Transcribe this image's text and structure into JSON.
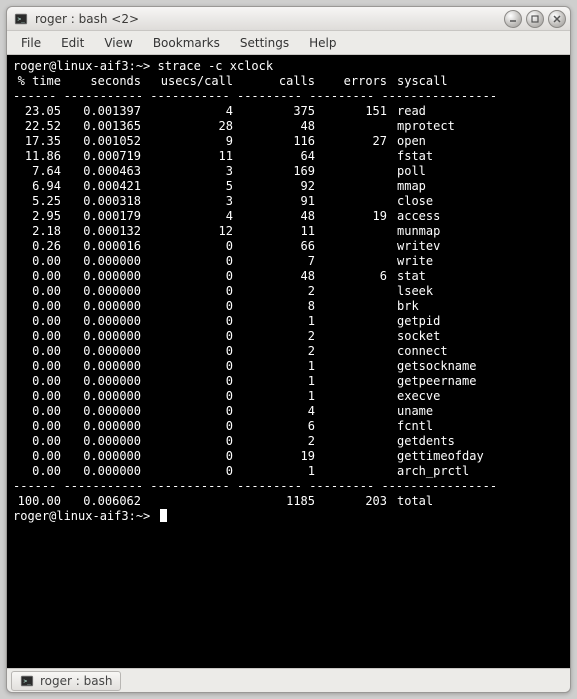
{
  "window": {
    "title": "roger : bash <2>"
  },
  "menus": {
    "file": "File",
    "edit": "Edit",
    "view": "View",
    "bookmarks": "Bookmarks",
    "settings": "Settings",
    "help": "Help"
  },
  "terminal": {
    "prompt": "roger@linux-aif3:~>",
    "command": "strace -c xclock",
    "header": {
      "time": "% time",
      "seconds": "seconds",
      "usecs": "usecs/call",
      "calls": "calls",
      "errors": "errors",
      "syscall": "syscall"
    },
    "dash": "------ ----------- ----------- --------- --------- ----------------",
    "rows": [
      {
        "time": "23.05",
        "seconds": "0.001397",
        "usecs": "4",
        "calls": "375",
        "errors": "151",
        "syscall": "read"
      },
      {
        "time": "22.52",
        "seconds": "0.001365",
        "usecs": "28",
        "calls": "48",
        "errors": "",
        "syscall": "mprotect"
      },
      {
        "time": "17.35",
        "seconds": "0.001052",
        "usecs": "9",
        "calls": "116",
        "errors": "27",
        "syscall": "open"
      },
      {
        "time": "11.86",
        "seconds": "0.000719",
        "usecs": "11",
        "calls": "64",
        "errors": "",
        "syscall": "fstat"
      },
      {
        "time": "7.64",
        "seconds": "0.000463",
        "usecs": "3",
        "calls": "169",
        "errors": "",
        "syscall": "poll"
      },
      {
        "time": "6.94",
        "seconds": "0.000421",
        "usecs": "5",
        "calls": "92",
        "errors": "",
        "syscall": "mmap"
      },
      {
        "time": "5.25",
        "seconds": "0.000318",
        "usecs": "3",
        "calls": "91",
        "errors": "",
        "syscall": "close"
      },
      {
        "time": "2.95",
        "seconds": "0.000179",
        "usecs": "4",
        "calls": "48",
        "errors": "19",
        "syscall": "access"
      },
      {
        "time": "2.18",
        "seconds": "0.000132",
        "usecs": "12",
        "calls": "11",
        "errors": "",
        "syscall": "munmap"
      },
      {
        "time": "0.26",
        "seconds": "0.000016",
        "usecs": "0",
        "calls": "66",
        "errors": "",
        "syscall": "writev"
      },
      {
        "time": "0.00",
        "seconds": "0.000000",
        "usecs": "0",
        "calls": "7",
        "errors": "",
        "syscall": "write"
      },
      {
        "time": "0.00",
        "seconds": "0.000000",
        "usecs": "0",
        "calls": "48",
        "errors": "6",
        "syscall": "stat"
      },
      {
        "time": "0.00",
        "seconds": "0.000000",
        "usecs": "0",
        "calls": "2",
        "errors": "",
        "syscall": "lseek"
      },
      {
        "time": "0.00",
        "seconds": "0.000000",
        "usecs": "0",
        "calls": "8",
        "errors": "",
        "syscall": "brk"
      },
      {
        "time": "0.00",
        "seconds": "0.000000",
        "usecs": "0",
        "calls": "1",
        "errors": "",
        "syscall": "getpid"
      },
      {
        "time": "0.00",
        "seconds": "0.000000",
        "usecs": "0",
        "calls": "2",
        "errors": "",
        "syscall": "socket"
      },
      {
        "time": "0.00",
        "seconds": "0.000000",
        "usecs": "0",
        "calls": "2",
        "errors": "",
        "syscall": "connect"
      },
      {
        "time": "0.00",
        "seconds": "0.000000",
        "usecs": "0",
        "calls": "1",
        "errors": "",
        "syscall": "getsockname"
      },
      {
        "time": "0.00",
        "seconds": "0.000000",
        "usecs": "0",
        "calls": "1",
        "errors": "",
        "syscall": "getpeername"
      },
      {
        "time": "0.00",
        "seconds": "0.000000",
        "usecs": "0",
        "calls": "1",
        "errors": "",
        "syscall": "execve"
      },
      {
        "time": "0.00",
        "seconds": "0.000000",
        "usecs": "0",
        "calls": "4",
        "errors": "",
        "syscall": "uname"
      },
      {
        "time": "0.00",
        "seconds": "0.000000",
        "usecs": "0",
        "calls": "6",
        "errors": "",
        "syscall": "fcntl"
      },
      {
        "time": "0.00",
        "seconds": "0.000000",
        "usecs": "0",
        "calls": "2",
        "errors": "",
        "syscall": "getdents"
      },
      {
        "time": "0.00",
        "seconds": "0.000000",
        "usecs": "0",
        "calls": "19",
        "errors": "",
        "syscall": "gettimeofday"
      },
      {
        "time": "0.00",
        "seconds": "0.000000",
        "usecs": "0",
        "calls": "1",
        "errors": "",
        "syscall": "arch_prctl"
      }
    ],
    "total": {
      "time": "100.00",
      "seconds": "0.006062",
      "usecs": "",
      "calls": "1185",
      "errors": "203",
      "syscall": "total"
    }
  },
  "statusbar": {
    "tab_label": "roger : bash"
  }
}
